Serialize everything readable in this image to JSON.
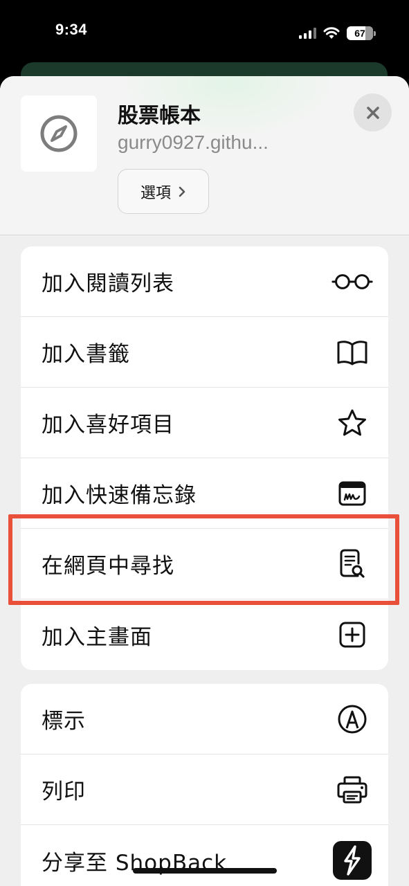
{
  "status_bar": {
    "time": "9:34",
    "battery": "67"
  },
  "header": {
    "site_title": "股票帳本",
    "site_url": "gurry0927.githu...",
    "options_label": "選項"
  },
  "menu_group_1": [
    {
      "label": "加入閱讀列表",
      "icon": "glasses-icon"
    },
    {
      "label": "加入書籤",
      "icon": "book-icon"
    },
    {
      "label": "加入喜好項目",
      "icon": "star-icon"
    },
    {
      "label": "加入快速備忘錄",
      "icon": "quick-note-icon"
    },
    {
      "label": "在網頁中尋找",
      "icon": "find-document-icon"
    },
    {
      "label": "加入主畫面",
      "icon": "plus-square-icon"
    }
  ],
  "menu_group_2": [
    {
      "label": "標示",
      "icon": "markup-pen-icon"
    },
    {
      "label": "列印",
      "icon": "printer-icon"
    },
    {
      "label": "分享至 ShopBack",
      "icon": "shopback-logo-icon"
    }
  ],
  "colors": {
    "highlight": "#e8503a",
    "sheet_bg": "#efefef"
  }
}
